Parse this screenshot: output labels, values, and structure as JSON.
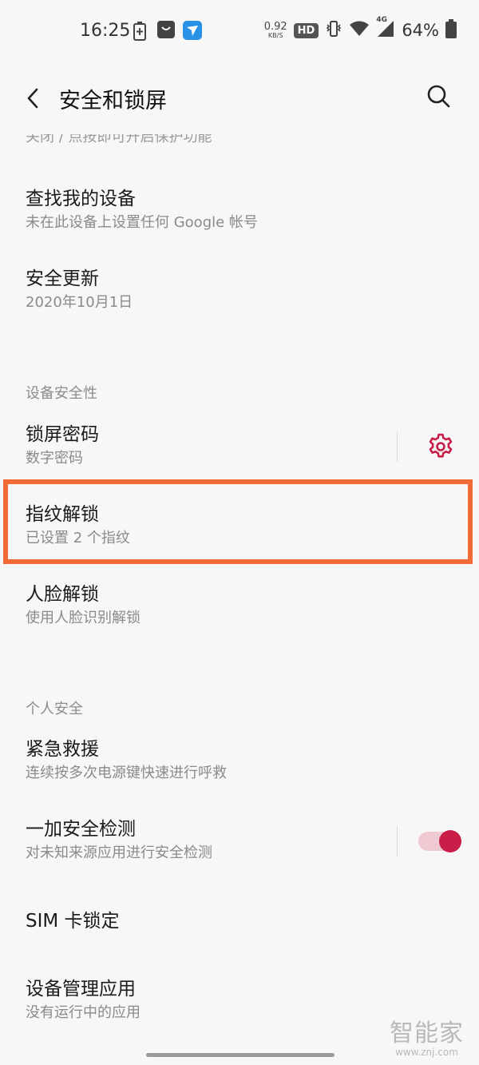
{
  "status_bar": {
    "time": "16:25",
    "net_speed_value": "0.92",
    "net_speed_unit": "KB/S",
    "hd_label": "HD",
    "network_label": "4G",
    "battery_percent": "64%"
  },
  "header": {
    "title": "安全和锁屏"
  },
  "partial_item": {
    "subtitle": "关闭 / 点按即可开启保护功能"
  },
  "items_top": [
    {
      "title": "查找我的设备",
      "subtitle": "未在此设备上设置任何 Google 帐号"
    },
    {
      "title": "安全更新",
      "subtitle": "2020年10月1日"
    }
  ],
  "section_device_security": {
    "label": "设备安全性",
    "items": [
      {
        "title": "锁屏密码",
        "subtitle": "数字密码"
      },
      {
        "title": "指纹解锁",
        "subtitle": "已设置 2 个指纹"
      },
      {
        "title": "人脸解锁",
        "subtitle": "使用人脸识别解锁"
      }
    ]
  },
  "section_personal_security": {
    "label": "个人安全",
    "items": [
      {
        "title": "紧急救援",
        "subtitle": "连续按多次电源键快速进行呼救"
      },
      {
        "title": "一加安全检测",
        "subtitle": "对未知来源应用进行安全检测",
        "toggle_on": true
      },
      {
        "title": "SIM 卡锁定"
      },
      {
        "title": "设备管理应用",
        "subtitle": "没有运行中的应用"
      }
    ]
  },
  "colors": {
    "accent": "#c81e48",
    "highlight_border": "#f26b37"
  },
  "watermark": {
    "cn": "智能家",
    "en": "www.znj.com"
  }
}
